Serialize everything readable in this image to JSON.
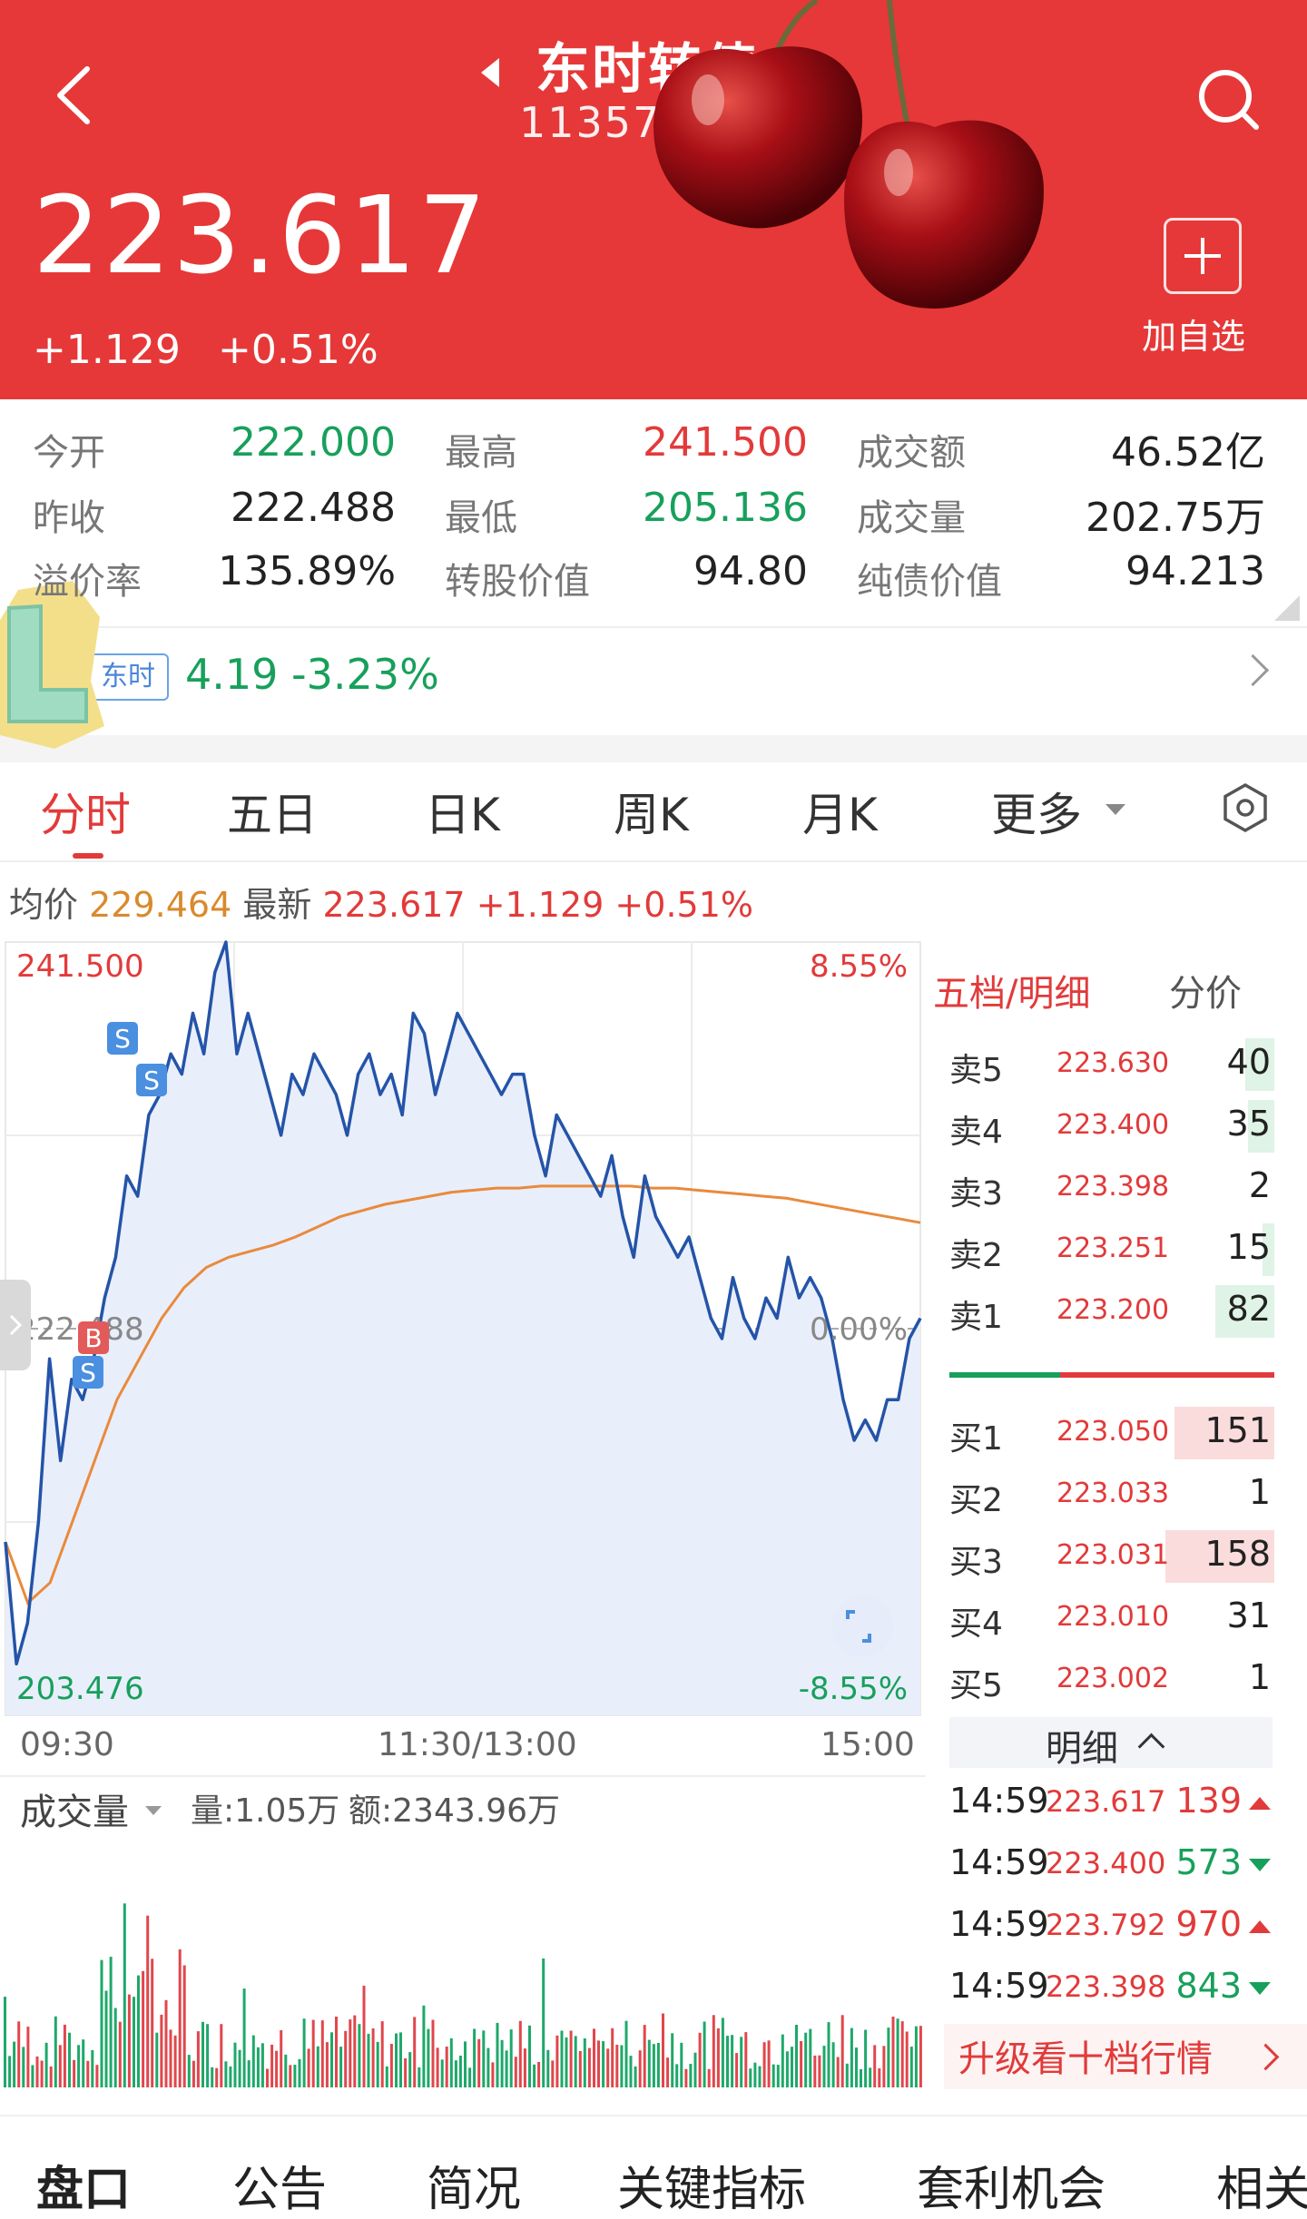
{
  "header": {
    "title": "东时转债",
    "code": "113575",
    "price": "223.617",
    "change": "+1.129",
    "change_pct": "+0.51%",
    "add_label": "加自选",
    "bg_color": "#e63838"
  },
  "stats": [
    [
      {
        "label": "今开",
        "value": "222.000",
        "color": "green"
      },
      {
        "label": "最高",
        "value": "241.500",
        "color": "red"
      },
      {
        "label": "成交额",
        "value": "46.52亿",
        "color": "normal"
      }
    ],
    [
      {
        "label": "昨收",
        "value": "222.488",
        "color": "normal"
      },
      {
        "label": "最低",
        "value": "205.136",
        "color": "green"
      },
      {
        "label": "成交量",
        "value": "202.75万",
        "color": "normal"
      }
    ],
    [
      {
        "label": "溢价率",
        "value": "135.89%",
        "color": "normal"
      },
      {
        "label": "转股价值",
        "value": "94.80",
        "color": "normal"
      },
      {
        "label": "纯债价值",
        "value": "94.213",
        "color": "normal"
      }
    ]
  ],
  "stock": {
    "tag": "东时",
    "quote": "4.19 -3.23%"
  },
  "tabs": [
    "分时",
    "五日",
    "日K",
    "周K",
    "月K",
    "更多"
  ],
  "info": {
    "avg_label": "均价",
    "avg": "229.464",
    "latest_label": "最新",
    "latest": "223.617",
    "change": "+1.129",
    "change_pct": "+0.51%"
  },
  "chart_data": {
    "type": "line",
    "title": "",
    "ylim": [
      203.476,
      241.5
    ],
    "y_labels": {
      "top": "241.500",
      "bottom": "203.476",
      "mid": "222.488"
    },
    "pct_labels": {
      "top": "8.55%",
      "mid": "0.00%",
      "bottom": "-8.55%"
    },
    "x_labels": [
      "09:30",
      "11:30/13:00",
      "15:00"
    ],
    "series": [
      {
        "values": [
          212,
          206,
          208,
          213,
          221,
          216,
          220,
          219,
          221,
          224,
          226,
          230,
          229,
          233,
          234,
          236,
          235,
          238,
          236,
          240,
          241.5,
          236,
          238,
          236,
          234,
          232,
          235,
          234,
          236,
          235,
          234,
          232,
          235,
          236,
          234,
          235,
          233,
          238,
          237,
          234,
          236,
          238,
          237,
          236,
          235,
          234,
          235,
          235,
          232,
          230,
          233,
          232,
          231,
          230,
          229,
          231,
          228,
          226,
          230,
          228,
          227,
          226,
          227,
          225,
          223,
          222,
          225,
          223,
          222,
          224,
          223,
          226,
          224,
          225,
          224,
          222,
          219,
          217,
          218,
          217,
          219,
          219,
          222,
          223
        ]
      },
      {
        "values": [
          212,
          209,
          210,
          213,
          216,
          219,
          221,
          223,
          224.5,
          225.5,
          226,
          226.3,
          226.6,
          227,
          227.5,
          228,
          228.3,
          228.6,
          228.8,
          229,
          229.2,
          229.3,
          229.4,
          229.4,
          229.5,
          229.5,
          229.5,
          229.5,
          229.5,
          229.4,
          229.4,
          229.3,
          229.2,
          229.1,
          229,
          228.9,
          228.7,
          228.5,
          228.3,
          228.1,
          227.9,
          227.7
        ]
      }
    ]
  },
  "volume": {
    "title": "成交量",
    "qty": "量:1.05万",
    "amt": "额:2343.96万"
  },
  "orderbook": {
    "title": "五档/明细",
    "tab2": "分价",
    "asks": [
      {
        "label": "卖5",
        "price": "223.630",
        "vol": "40",
        "ratio": 0.25
      },
      {
        "label": "卖4",
        "price": "223.400",
        "vol": "35",
        "ratio": 0.22
      },
      {
        "label": "卖3",
        "price": "223.398",
        "vol": "2",
        "ratio": 0.0
      },
      {
        "label": "卖2",
        "price": "223.251",
        "vol": "15",
        "ratio": 0.1
      },
      {
        "label": "卖1",
        "price": "223.200",
        "vol": "82",
        "ratio": 0.5
      }
    ],
    "bids": [
      {
        "label": "买1",
        "price": "223.050",
        "vol": "151",
        "ratio": 0.92
      },
      {
        "label": "买2",
        "price": "223.033",
        "vol": "1",
        "ratio": 0.0
      },
      {
        "label": "买3",
        "price": "223.031",
        "vol": "158",
        "ratio": 1.0
      },
      {
        "label": "买4",
        "price": "223.010",
        "vol": "31",
        "ratio": 0.0
      },
      {
        "label": "买5",
        "price": "223.002",
        "vol": "1",
        "ratio": 0.0
      }
    ],
    "detail_label": "明细",
    "ticks": [
      {
        "time": "14:59",
        "price": "223.617",
        "vol": "139",
        "dir": "up"
      },
      {
        "time": "14:59",
        "price": "223.400",
        "vol": "573",
        "dir": "down"
      },
      {
        "time": "14:59",
        "price": "223.792",
        "vol": "970",
        "dir": "up"
      },
      {
        "time": "14:59",
        "price": "223.398",
        "vol": "843",
        "dir": "down"
      }
    ],
    "upgrade": "升级看十档行情"
  },
  "bottom_tabs": [
    "盘口",
    "公告",
    "简况",
    "关键指标",
    "套利机会",
    "相关"
  ]
}
